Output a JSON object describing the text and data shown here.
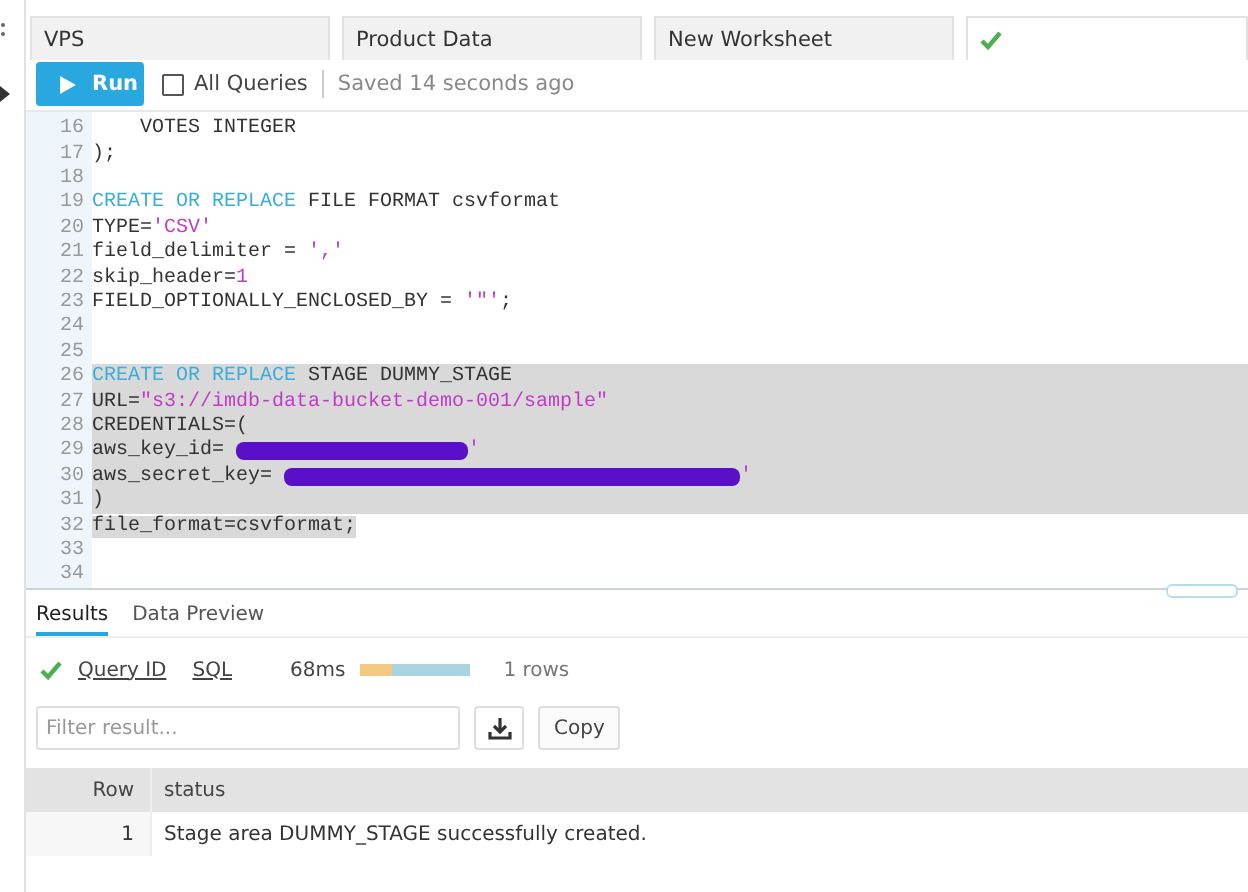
{
  "worksheet_tabs": [
    {
      "kind": "text",
      "label": "VPS",
      "selected": false
    },
    {
      "kind": "text",
      "label": "Product Data",
      "selected": false
    },
    {
      "kind": "text",
      "label": "New Worksheet",
      "selected": false
    },
    {
      "kind": "status",
      "selected": true
    }
  ],
  "toolbar": {
    "run_button": "Run",
    "all_queries": {
      "label": "All Queries",
      "checked": false
    },
    "saved_text": "Saved 14 seconds ago"
  },
  "editor": {
    "lines": [
      {
        "num": "16",
        "selected": false,
        "tokens": [
          {
            "kind": "plain",
            "text": "    VOTES INTEGER"
          }
        ]
      },
      {
        "num": "17",
        "selected": false,
        "tokens": [
          {
            "kind": "plain",
            "text": ");"
          }
        ]
      },
      {
        "num": "18",
        "selected": false
      },
      {
        "num": "19",
        "selected": false,
        "tokens": [
          {
            "kind": "keyword",
            "text": "CREATE OR REPLACE"
          },
          {
            "kind": "plain",
            "text": " FILE FORMAT csvformat"
          }
        ]
      },
      {
        "num": "20",
        "selected": false,
        "tokens": [
          {
            "kind": "plain",
            "text": "TYPE="
          },
          {
            "kind": "string",
            "text": "'CSV'"
          }
        ]
      },
      {
        "num": "21",
        "selected": false,
        "tokens": [
          {
            "kind": "plain",
            "text": "field_delimiter = "
          },
          {
            "kind": "string",
            "text": "','"
          }
        ]
      },
      {
        "num": "22",
        "selected": false,
        "tokens": [
          {
            "kind": "plain",
            "text": "skip_header="
          },
          {
            "kind": "string",
            "text": "1"
          }
        ]
      },
      {
        "num": "23",
        "selected": false,
        "tokens": [
          {
            "kind": "plain",
            "text": "FIELD_OPTIONALLY_ENCLOSED_BY = "
          },
          {
            "kind": "string",
            "text": "'\"'"
          },
          {
            "kind": "plain",
            "text": ";"
          }
        ]
      },
      {
        "num": "24",
        "selected": false
      },
      {
        "num": "25",
        "selected": false
      },
      {
        "num": "26",
        "selected": true,
        "tokens": [
          {
            "kind": "keyword",
            "text": "CREATE OR REPLACE"
          },
          {
            "kind": "plain",
            "text": " STAGE DUMMY_STAGE"
          }
        ]
      },
      {
        "num": "27",
        "selected": true,
        "tokens": [
          {
            "kind": "plain",
            "text": "URL="
          },
          {
            "kind": "string",
            "text": "\"s3://imdb-data-bucket-demo-001/sample\""
          }
        ]
      },
      {
        "num": "28",
        "selected": true,
        "tokens": [
          {
            "kind": "plain",
            "text": "CREDENTIALS=("
          }
        ]
      },
      {
        "num": "29",
        "selected": true,
        "tokens": [
          {
            "kind": "plain",
            "text": "aws_key_id= "
          },
          {
            "kind": "redacted"
          },
          {
            "kind": "string",
            "text": "'"
          }
        ]
      },
      {
        "num": "30",
        "selected": true,
        "tokens": [
          {
            "kind": "plain",
            "text": "aws_secret_key= "
          },
          {
            "kind": "redacted"
          },
          {
            "kind": "string",
            "text": "'"
          }
        ]
      },
      {
        "num": "31",
        "selected": true,
        "tokens": [
          {
            "kind": "plain",
            "text": ")"
          }
        ]
      },
      {
        "num": "32",
        "selected": true,
        "tokens": [
          {
            "kind": "plain",
            "text": "file_format=csvformat;"
          }
        ]
      },
      {
        "num": "33",
        "selected": false
      },
      {
        "num": "34",
        "selected": false
      }
    ]
  },
  "result_tabs": [
    {
      "label": "Results",
      "selected": true
    },
    {
      "label": "Data Preview",
      "selected": false
    }
  ],
  "query_info": {
    "succeeded": true,
    "query_id_link": "Query ID",
    "sql_link": "SQL",
    "duration": "68ms",
    "timing": {
      "level": 0.3
    },
    "rows": "1 rows"
  },
  "filter": {
    "placeholder": "Filter result..."
  },
  "copy_button": "Copy",
  "table": {
    "columns": [
      "Row",
      "status"
    ],
    "rows": [
      [
        "1",
        "Stage area DUMMY_STAGE successfully created."
      ]
    ]
  }
}
